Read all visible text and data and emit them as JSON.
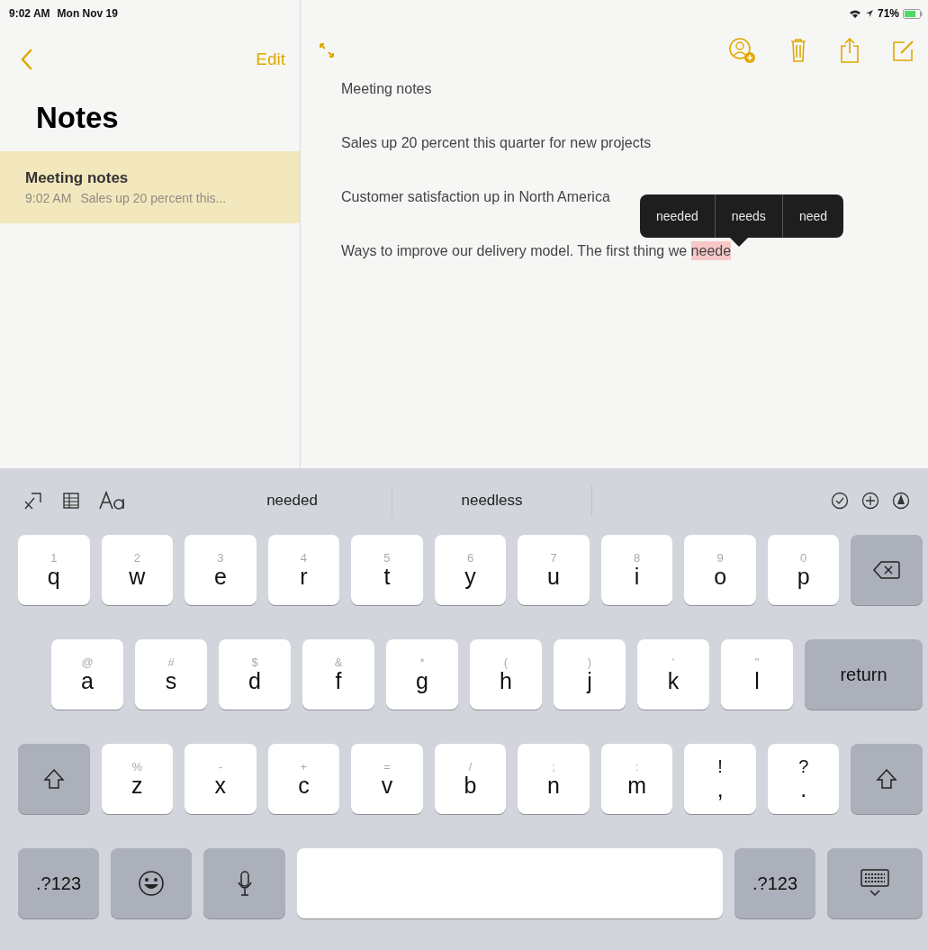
{
  "status_bar": {
    "time": "9:02 AM",
    "date": "Mon Nov 19",
    "battery": "71%"
  },
  "sidebar": {
    "edit": "Edit",
    "title": "Notes",
    "notes": [
      {
        "title": "Meeting notes",
        "time": "9:02 AM",
        "preview": "Sales up 20 percent this...",
        "selected": true
      }
    ]
  },
  "note": {
    "lines": [
      {
        "text": "Meeting notes"
      },
      {
        "text": "Sales up 20 percent this quarter for new projects"
      },
      {
        "text": "Customer satisfaction up in North America"
      },
      {
        "text": "Ways to improve our delivery model. The first thing we",
        "misspelled": "neede"
      }
    ],
    "suggestions": [
      {
        "label": "needed"
      },
      {
        "label": "needs"
      },
      {
        "label": "need"
      }
    ]
  },
  "keyboard": {
    "predictions": [
      "needed",
      "needless"
    ],
    "rows": [
      [
        {
          "kind": "letter",
          "hint": "1",
          "label": "q"
        },
        {
          "kind": "letter",
          "hint": "2",
          "label": "w"
        },
        {
          "kind": "letter",
          "hint": "3",
          "label": "e"
        },
        {
          "kind": "letter",
          "hint": "4",
          "label": "r"
        },
        {
          "kind": "letter",
          "hint": "5",
          "label": "t"
        },
        {
          "kind": "letter",
          "hint": "6",
          "label": "y"
        },
        {
          "kind": "letter",
          "hint": "7",
          "label": "u"
        },
        {
          "kind": "letter",
          "hint": "8",
          "label": "i"
        },
        {
          "kind": "letter",
          "hint": "9",
          "label": "o"
        },
        {
          "kind": "letter",
          "hint": "0",
          "label": "p"
        },
        {
          "kind": "delete"
        }
      ],
      [
        {
          "kind": "letter",
          "hint": "@",
          "label": "a"
        },
        {
          "kind": "letter",
          "hint": "#",
          "label": "s"
        },
        {
          "kind": "letter",
          "hint": "$",
          "label": "d"
        },
        {
          "kind": "letter",
          "hint": "&",
          "label": "f"
        },
        {
          "kind": "letter",
          "hint": "*",
          "label": "g"
        },
        {
          "kind": "letter",
          "hint": "(",
          "label": "h"
        },
        {
          "kind": "letter",
          "hint": ")",
          "label": "j"
        },
        {
          "kind": "letter",
          "hint": "'",
          "label": "k"
        },
        {
          "kind": "letter",
          "hint": "\"",
          "label": "l"
        },
        {
          "kind": "return",
          "label": "return"
        }
      ],
      [
        {
          "kind": "shift"
        },
        {
          "kind": "letter",
          "hint": "%",
          "label": "z"
        },
        {
          "kind": "letter",
          "hint": "-",
          "label": "x"
        },
        {
          "kind": "letter",
          "hint": "+",
          "label": "c"
        },
        {
          "kind": "letter",
          "hint": "=",
          "label": "v"
        },
        {
          "kind": "letter",
          "hint": "/",
          "label": "b"
        },
        {
          "kind": "letter",
          "hint": ";",
          "label": "n"
        },
        {
          "kind": "letter",
          "hint": ":",
          "label": "m"
        },
        {
          "kind": "punct",
          "hint": "!",
          "label": ","
        },
        {
          "kind": "punct",
          "hint": "?",
          "label": "."
        },
        {
          "kind": "shift"
        }
      ],
      [
        {
          "kind": "numbers",
          "label": ".?123"
        },
        {
          "kind": "emoji"
        },
        {
          "kind": "dictation"
        },
        {
          "kind": "space"
        },
        {
          "kind": "numbers",
          "label": ".?123"
        },
        {
          "kind": "hide"
        }
      ]
    ]
  }
}
